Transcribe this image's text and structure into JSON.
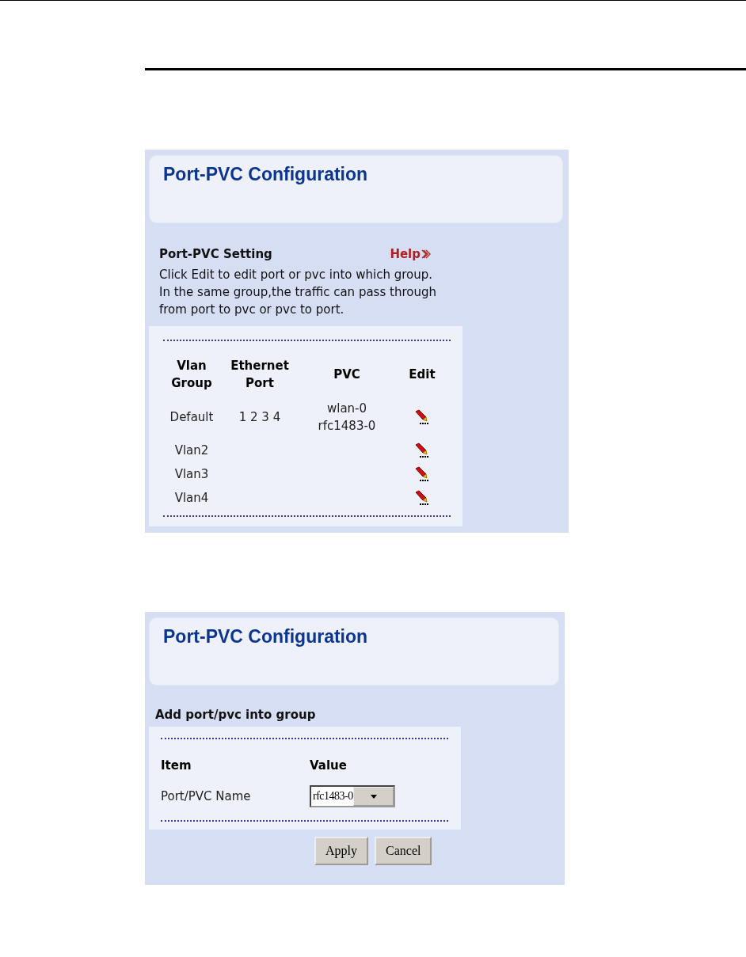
{
  "panels": [
    {
      "title": "Port-PVC Configuration",
      "heading": "Port-PVC Setting",
      "help": "Help",
      "description": [
        "Click Edit to edit port or pvc into which group.",
        "In the same group,the traffic can pass through from port to pvc or pvc to port."
      ],
      "table": {
        "columns": [
          "Vlan Group",
          "Ethernet Port",
          "PVC",
          "Edit"
        ],
        "rows": [
          {
            "group": "Default",
            "ports": "1 2 3 4",
            "pvc": [
              "wlan-0",
              "rfc1483-0"
            ]
          },
          {
            "group": "Vlan2",
            "ports": "",
            "pvc": []
          },
          {
            "group": "Vlan3",
            "ports": "",
            "pvc": []
          },
          {
            "group": "Vlan4",
            "ports": "",
            "pvc": []
          }
        ]
      }
    },
    {
      "title": "Port-PVC Configuration",
      "heading": "Add port/pvc into group",
      "form": {
        "columns": [
          "Item",
          "Value"
        ],
        "rows": [
          {
            "label": "Port/PVC Name",
            "value": "rfc1483-0"
          }
        ]
      },
      "buttons": [
        "Apply",
        "Cancel"
      ]
    }
  ]
}
